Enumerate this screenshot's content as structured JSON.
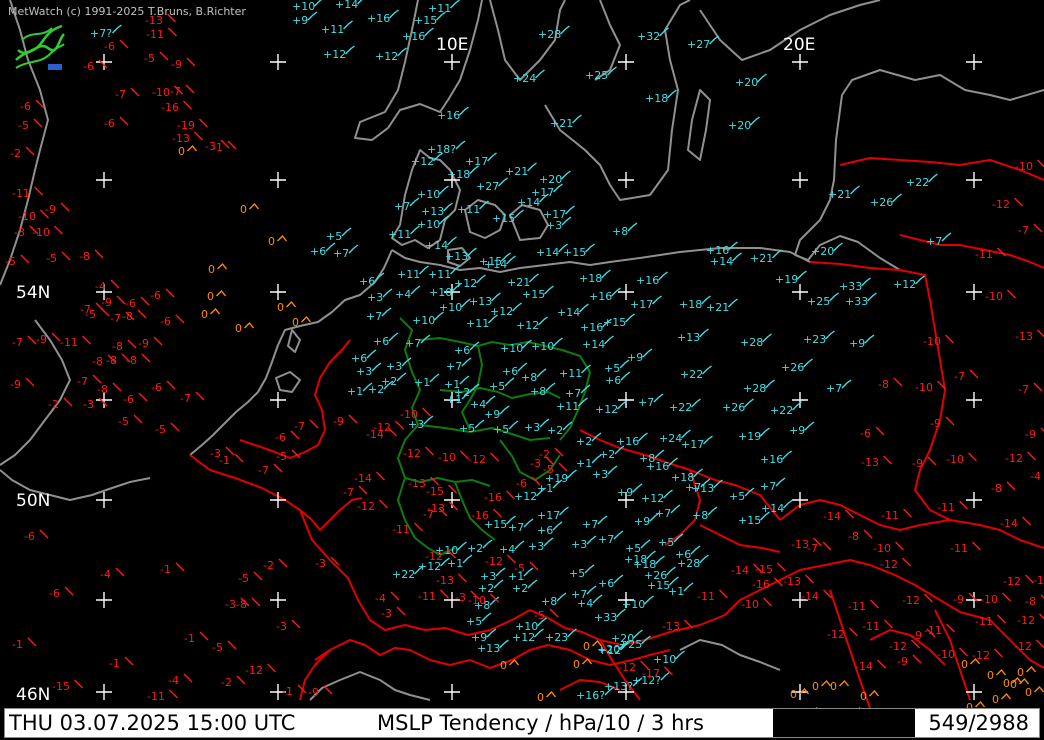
{
  "copyright": "MetWatch  (c) 1991-2025 T.Bruns, B.Richter",
  "footer": {
    "datetime": "THU 03.07.2025 15:00 UTC",
    "parameter": "MSLP Tendency / hPa/10 / 3 hrs",
    "counter": "549/2988"
  },
  "grid_labels": {
    "lon_10e": "10E",
    "lon_20e": "20E",
    "lat_54n": "54N",
    "lat_50n": "50N",
    "lat_46n": "46N"
  },
  "colors": {
    "background": "#000000",
    "positive": "#40e0e8",
    "negative": "#ff1818",
    "zero": "#ff8c00",
    "coastline": "#909090",
    "border_international": "#e00000",
    "border_germany": "#0f7a0f",
    "grid_cross": "#ffffff"
  },
  "observations": [
    {
      "v": "+10",
      "c": "pos"
    },
    {
      "v": "+14",
      "c": "pos"
    },
    {
      "v": "+11",
      "c": "pos"
    },
    {
      "v": "+9",
      "c": "pos"
    },
    {
      "v": "+16",
      "c": "pos"
    },
    {
      "v": "+15",
      "c": "pos"
    },
    {
      "v": "+11",
      "c": "pos"
    },
    {
      "v": "+16",
      "c": "pos"
    },
    {
      "v": "+12",
      "c": "pos"
    },
    {
      "v": "+12",
      "c": "pos"
    },
    {
      "v": "+28",
      "c": "pos"
    },
    {
      "v": "+32",
      "c": "pos"
    },
    {
      "v": "+27",
      "c": "pos"
    },
    {
      "v": "+24",
      "c": "pos"
    },
    {
      "v": "+25",
      "c": "pos"
    },
    {
      "v": "+20",
      "c": "pos"
    },
    {
      "v": "+18",
      "c": "pos"
    },
    {
      "v": "+20",
      "c": "pos"
    },
    {
      "v": "+21",
      "c": "pos"
    },
    {
      "v": "+16",
      "c": "pos"
    },
    {
      "v": "+18?",
      "c": "pos"
    },
    {
      "v": "+12",
      "c": "pos"
    },
    {
      "v": "+17",
      "c": "pos"
    },
    {
      "v": "+21",
      "c": "pos"
    },
    {
      "v": "+18",
      "c": "pos"
    },
    {
      "v": "+20",
      "c": "pos"
    },
    {
      "v": "+27",
      "c": "pos"
    },
    {
      "v": "+17",
      "c": "pos"
    },
    {
      "v": "+10",
      "c": "pos"
    },
    {
      "v": "+13",
      "c": "pos"
    },
    {
      "v": "+11",
      "c": "pos"
    },
    {
      "v": "+14",
      "c": "pos"
    },
    {
      "v": "+15",
      "c": "pos"
    },
    {
      "v": "+17",
      "c": "pos"
    },
    {
      "v": "+3",
      "c": "pos"
    },
    {
      "v": "+7",
      "c": "pos"
    },
    {
      "v": "+10",
      "c": "pos"
    },
    {
      "v": "+11",
      "c": "pos"
    },
    {
      "v": "+14",
      "c": "pos"
    },
    {
      "v": "+8",
      "c": "pos"
    },
    {
      "v": "+22",
      "c": "pos"
    },
    {
      "v": "+26",
      "c": "pos"
    },
    {
      "v": "+21",
      "c": "pos"
    },
    {
      "v": "+5",
      "c": "pos"
    },
    {
      "v": "+6",
      "c": "pos"
    },
    {
      "v": "+7",
      "c": "pos"
    },
    {
      "v": "+13",
      "c": "pos"
    },
    {
      "v": "+15",
      "c": "pos"
    },
    {
      "v": "+14",
      "c": "pos"
    },
    {
      "v": "+16",
      "c": "pos"
    },
    {
      "v": "+14",
      "c": "pos"
    },
    {
      "v": "+15",
      "c": "pos"
    },
    {
      "v": "+21",
      "c": "pos"
    },
    {
      "v": "+20",
      "c": "pos"
    },
    {
      "v": "+7",
      "c": "pos"
    },
    {
      "v": "+11",
      "c": "pos"
    },
    {
      "v": "+11",
      "c": "pos"
    },
    {
      "v": "+14",
      "c": "pos"
    },
    {
      "v": "+18",
      "c": "pos"
    },
    {
      "v": "+6",
      "c": "pos"
    },
    {
      "v": "+12",
      "c": "pos"
    },
    {
      "v": "+21",
      "c": "pos"
    },
    {
      "v": "+16",
      "c": "pos"
    },
    {
      "v": "+19",
      "c": "pos"
    },
    {
      "v": "+33",
      "c": "pos"
    },
    {
      "v": "+12",
      "c": "pos"
    },
    {
      "v": "+3",
      "c": "pos"
    },
    {
      "v": "+4",
      "c": "pos"
    },
    {
      "v": "+10",
      "c": "pos"
    },
    {
      "v": "+13",
      "c": "pos"
    },
    {
      "v": "+15",
      "c": "pos"
    },
    {
      "v": "+16",
      "c": "pos"
    },
    {
      "v": "+17",
      "c": "pos"
    },
    {
      "v": "+18",
      "c": "pos"
    },
    {
      "v": "+21",
      "c": "pos"
    },
    {
      "v": "+25",
      "c": "pos"
    },
    {
      "v": "+33",
      "c": "pos"
    },
    {
      "v": "+7",
      "c": "pos"
    },
    {
      "v": "+10",
      "c": "pos"
    },
    {
      "v": "+12",
      "c": "pos"
    },
    {
      "v": "+14",
      "c": "pos"
    },
    {
      "v": "+10",
      "c": "pos"
    },
    {
      "v": "+11",
      "c": "pos"
    },
    {
      "v": "+12",
      "c": "pos"
    },
    {
      "v": "+16",
      "c": "pos"
    },
    {
      "v": "+15",
      "c": "pos"
    },
    {
      "v": "+6",
      "c": "pos"
    },
    {
      "v": "+7",
      "c": "pos"
    },
    {
      "v": "+6",
      "c": "pos"
    },
    {
      "v": "+10",
      "c": "pos"
    },
    {
      "v": "+10",
      "c": "pos"
    },
    {
      "v": "+14",
      "c": "pos"
    },
    {
      "v": "+13",
      "c": "pos"
    },
    {
      "v": "+28",
      "c": "pos"
    },
    {
      "v": "+23",
      "c": "pos"
    },
    {
      "v": "+9",
      "c": "pos"
    },
    {
      "v": "+6",
      "c": "pos"
    },
    {
      "v": "+3",
      "c": "pos"
    },
    {
      "v": "+3",
      "c": "pos"
    },
    {
      "v": "+2",
      "c": "pos"
    },
    {
      "v": "+7",
      "c": "pos"
    },
    {
      "v": "+6",
      "c": "pos"
    },
    {
      "v": "+8",
      "c": "pos"
    },
    {
      "v": "+11",
      "c": "pos"
    },
    {
      "v": "+5",
      "c": "pos"
    },
    {
      "v": "+6",
      "c": "pos"
    },
    {
      "v": "+9",
      "c": "pos"
    },
    {
      "v": "+22",
      "c": "pos"
    },
    {
      "v": "+26",
      "c": "pos"
    },
    {
      "v": "+28",
      "c": "pos"
    },
    {
      "v": "+7",
      "c": "pos"
    },
    {
      "v": "+2",
      "c": "pos"
    },
    {
      "v": "+1",
      "c": "pos"
    },
    {
      "v": "+1",
      "c": "pos"
    },
    {
      "v": "+1",
      "c": "pos"
    },
    {
      "v": "+2",
      "c": "pos"
    },
    {
      "v": "+5",
      "c": "pos"
    },
    {
      "v": "+8",
      "c": "pos"
    },
    {
      "v": "+7",
      "c": "pos"
    },
    {
      "v": "+7",
      "c": "pos"
    },
    {
      "v": "+22",
      "c": "pos"
    },
    {
      "v": "+26",
      "c": "pos"
    },
    {
      "v": "+22",
      "c": "pos"
    },
    {
      "v": "+4",
      "c": "pos"
    },
    {
      "v": "+9",
      "c": "pos"
    },
    {
      "v": "+1",
      "c": "pos"
    },
    {
      "v": "+3",
      "c": "pos"
    },
    {
      "v": "+5",
      "c": "pos"
    },
    {
      "v": "+5",
      "c": "pos"
    },
    {
      "v": "+3",
      "c": "pos"
    },
    {
      "v": "+2",
      "c": "pos"
    },
    {
      "v": "+16",
      "c": "pos"
    },
    {
      "v": "+24",
      "c": "pos"
    },
    {
      "v": "+17",
      "c": "pos"
    },
    {
      "v": "+19",
      "c": "pos"
    },
    {
      "v": "+9",
      "c": "pos"
    },
    {
      "v": "+2",
      "c": "pos"
    },
    {
      "v": "+2",
      "c": "pos"
    },
    {
      "v": "+8",
      "c": "pos"
    },
    {
      "v": "+16",
      "c": "pos"
    },
    {
      "v": "+16",
      "c": "pos"
    },
    {
      "v": "+11",
      "c": "pos"
    },
    {
      "v": "+12",
      "c": "pos"
    },
    {
      "v": "+1",
      "c": "pos"
    },
    {
      "v": "+3",
      "c": "pos"
    },
    {
      "v": "+19",
      "c": "pos"
    },
    {
      "v": "+12",
      "c": "pos"
    },
    {
      "v": "+1",
      "c": "pos"
    },
    {
      "v": "+9",
      "c": "pos"
    },
    {
      "v": "+12",
      "c": "pos"
    },
    {
      "v": "+18",
      "c": "pos"
    },
    {
      "v": "+13",
      "c": "pos"
    },
    {
      "v": "+5",
      "c": "pos"
    },
    {
      "v": "+7",
      "c": "pos"
    },
    {
      "v": "+14",
      "c": "pos"
    },
    {
      "v": "+7",
      "c": "pos"
    },
    {
      "v": "+8",
      "c": "pos"
    },
    {
      "v": "+7",
      "c": "pos"
    },
    {
      "v": "+9",
      "c": "pos"
    },
    {
      "v": "+7",
      "c": "pos"
    },
    {
      "v": "+17",
      "c": "pos"
    },
    {
      "v": "+15",
      "c": "pos"
    },
    {
      "v": "+7",
      "c": "pos"
    },
    {
      "v": "+6",
      "c": "pos"
    },
    {
      "v": "+3",
      "c": "pos"
    },
    {
      "v": "+7",
      "c": "pos"
    },
    {
      "v": "+5",
      "c": "pos"
    },
    {
      "v": "+5",
      "c": "pos"
    },
    {
      "v": "+6",
      "c": "pos"
    },
    {
      "v": "+18",
      "c": "pos"
    },
    {
      "v": "+18",
      "c": "pos"
    },
    {
      "v": "+28",
      "c": "pos"
    },
    {
      "v": "+15",
      "c": "pos"
    },
    {
      "v": "+22",
      "c": "pos"
    },
    {
      "v": "+12",
      "c": "pos"
    },
    {
      "v": "+10",
      "c": "pos"
    },
    {
      "v": "+3",
      "c": "pos"
    },
    {
      "v": "+1",
      "c": "pos"
    },
    {
      "v": "+1",
      "c": "pos"
    },
    {
      "v": "+2",
      "c": "pos"
    },
    {
      "v": "+4",
      "c": "pos"
    },
    {
      "v": "+3",
      "c": "pos"
    },
    {
      "v": "+5",
      "c": "pos"
    },
    {
      "v": "+26",
      "c": "pos"
    },
    {
      "v": "+2",
      "c": "pos"
    },
    {
      "v": "+2",
      "c": "pos"
    },
    {
      "v": "+6",
      "c": "pos"
    },
    {
      "v": "+7",
      "c": "pos"
    },
    {
      "v": "+15",
      "c": "pos"
    },
    {
      "v": "+1",
      "c": "pos"
    },
    {
      "v": "+8",
      "c": "pos"
    },
    {
      "v": "+8",
      "c": "pos"
    },
    {
      "v": "+4",
      "c": "pos"
    },
    {
      "v": "+10",
      "c": "pos"
    },
    {
      "v": "+5",
      "c": "pos"
    },
    {
      "v": "+10",
      "c": "pos"
    },
    {
      "v": "+33",
      "c": "pos"
    },
    {
      "v": "+12",
      "c": "pos"
    },
    {
      "v": "+23",
      "c": "pos"
    },
    {
      "v": "+20",
      "c": "pos"
    },
    {
      "v": "+25",
      "c": "pos"
    },
    {
      "v": "+12",
      "c": "pos"
    },
    {
      "v": "+20",
      "c": "pos"
    },
    {
      "v": "+9",
      "c": "pos"
    },
    {
      "v": "+13",
      "c": "pos"
    },
    {
      "v": "+10",
      "c": "pos"
    },
    {
      "v": "+12?",
      "c": "pos"
    },
    {
      "v": "+13?",
      "c": "pos"
    },
    {
      "v": "+16?",
      "c": "pos"
    },
    {
      "v": "+7?",
      "c": "pos"
    },
    {
      "v": "-13",
      "c": "neg"
    },
    {
      "v": "-6",
      "c": "neg"
    },
    {
      "v": "-11",
      "c": "neg"
    },
    {
      "v": "-5",
      "c": "neg"
    },
    {
      "v": "-9",
      "c": "neg"
    },
    {
      "v": "-6",
      "c": "neg"
    },
    {
      "v": "-7",
      "c": "neg"
    },
    {
      "v": "-7",
      "c": "neg"
    },
    {
      "v": "-10",
      "c": "neg"
    },
    {
      "v": "-6",
      "c": "neg"
    },
    {
      "v": "-16",
      "c": "neg"
    },
    {
      "v": "-6",
      "c": "neg"
    },
    {
      "v": "-19",
      "c": "neg"
    },
    {
      "v": "-5",
      "c": "neg"
    },
    {
      "v": "-13",
      "c": "neg"
    },
    {
      "v": "-3",
      "c": "neg"
    },
    {
      "v": "-1",
      "c": "neg"
    },
    {
      "v": "-2",
      "c": "neg"
    },
    {
      "v": "-11",
      "c": "neg"
    },
    {
      "v": "-9",
      "c": "neg"
    },
    {
      "v": "-10",
      "c": "neg"
    },
    {
      "v": "-8",
      "c": "neg"
    },
    {
      "v": "-10",
      "c": "neg"
    },
    {
      "v": "-5",
      "c": "neg"
    },
    {
      "v": "-5",
      "c": "neg"
    },
    {
      "v": "-8",
      "c": "neg"
    },
    {
      "v": "-4",
      "c": "neg"
    },
    {
      "v": "-6",
      "c": "neg"
    },
    {
      "v": "-6",
      "c": "neg"
    },
    {
      "v": "-9",
      "c": "neg"
    },
    {
      "v": "-7",
      "c": "neg"
    },
    {
      "v": "-6",
      "c": "neg"
    },
    {
      "v": "-8",
      "c": "neg"
    },
    {
      "v": "-5",
      "c": "neg"
    },
    {
      "v": "-7",
      "c": "neg"
    },
    {
      "v": "-8",
      "c": "neg"
    },
    {
      "v": "-9",
      "c": "neg"
    },
    {
      "v": "-7",
      "c": "neg"
    },
    {
      "v": "-9",
      "c": "neg"
    },
    {
      "v": "-11",
      "c": "neg"
    },
    {
      "v": "-8",
      "c": "neg"
    },
    {
      "v": "-8",
      "c": "neg"
    },
    {
      "v": "-8",
      "c": "neg"
    },
    {
      "v": "-9",
      "c": "neg"
    },
    {
      "v": "-7",
      "c": "neg"
    },
    {
      "v": "-3",
      "c": "neg"
    },
    {
      "v": "-8",
      "c": "neg"
    },
    {
      "v": "-6",
      "c": "neg"
    },
    {
      "v": "-5",
      "c": "neg"
    },
    {
      "v": "-2",
      "c": "neg"
    },
    {
      "v": "-7",
      "c": "neg"
    },
    {
      "v": "-6",
      "c": "neg"
    },
    {
      "v": "-5",
      "c": "neg"
    },
    {
      "v": "-3",
      "c": "neg"
    },
    {
      "v": "-1",
      "c": "neg"
    },
    {
      "v": "-6",
      "c": "neg"
    },
    {
      "v": "-5",
      "c": "neg"
    },
    {
      "v": "-7",
      "c": "neg"
    },
    {
      "v": "-9",
      "c": "neg"
    },
    {
      "v": "-7",
      "c": "neg"
    },
    {
      "v": "-12",
      "c": "neg"
    },
    {
      "v": "-10",
      "c": "neg"
    },
    {
      "v": "-14",
      "c": "neg"
    },
    {
      "v": "-12",
      "c": "neg"
    },
    {
      "v": "-10",
      "c": "neg"
    },
    {
      "v": "-12",
      "c": "neg"
    },
    {
      "v": "-13",
      "c": "neg"
    },
    {
      "v": "-15",
      "c": "neg"
    },
    {
      "v": "-14",
      "c": "neg"
    },
    {
      "v": "-7",
      "c": "neg"
    },
    {
      "v": "-12",
      "c": "neg"
    },
    {
      "v": "-13",
      "c": "neg"
    },
    {
      "v": "-16",
      "c": "neg"
    },
    {
      "v": "-16",
      "c": "neg"
    },
    {
      "v": "-7",
      "c": "neg"
    },
    {
      "v": "-11",
      "c": "neg"
    },
    {
      "v": "-12",
      "c": "neg"
    },
    {
      "v": "-11",
      "c": "neg"
    },
    {
      "v": "-13",
      "c": "neg"
    },
    {
      "v": "-3",
      "c": "neg"
    },
    {
      "v": "-10",
      "c": "neg"
    },
    {
      "v": "-12",
      "c": "neg"
    },
    {
      "v": "-5",
      "c": "neg"
    },
    {
      "v": "-4",
      "c": "neg"
    },
    {
      "v": "-3",
      "c": "neg"
    },
    {
      "v": "-5",
      "c": "neg"
    },
    {
      "v": "-6",
      "c": "neg"
    },
    {
      "v": "-2",
      "c": "neg"
    },
    {
      "v": "-3",
      "c": "neg"
    },
    {
      "v": "-5",
      "c": "neg"
    },
    {
      "v": "-6",
      "c": "neg"
    },
    {
      "v": "-1",
      "c": "neg"
    },
    {
      "v": "-4",
      "c": "neg"
    },
    {
      "v": "-5",
      "c": "neg"
    },
    {
      "v": "-2",
      "c": "neg"
    },
    {
      "v": "-3",
      "c": "neg"
    },
    {
      "v": "-8",
      "c": "neg"
    },
    {
      "v": "-3",
      "c": "neg"
    },
    {
      "v": "-1",
      "c": "neg"
    },
    {
      "v": "-5",
      "c": "neg"
    },
    {
      "v": "-1",
      "c": "neg"
    },
    {
      "v": "-6",
      "c": "neg"
    },
    {
      "v": "-3",
      "c": "neg"
    },
    {
      "v": "-1",
      "c": "neg"
    },
    {
      "v": "-4",
      "c": "neg"
    },
    {
      "v": "-2",
      "c": "neg"
    },
    {
      "v": "-12",
      "c": "neg"
    },
    {
      "v": "-1",
      "c": "neg"
    },
    {
      "v": "-9",
      "c": "neg"
    },
    {
      "v": "-15",
      "c": "neg"
    },
    {
      "v": "-11",
      "c": "neg"
    },
    {
      "v": "-10",
      "c": "neg"
    },
    {
      "v": "-12",
      "c": "neg"
    },
    {
      "v": "-7",
      "c": "neg"
    },
    {
      "v": "-11",
      "c": "neg"
    },
    {
      "v": "-10",
      "c": "neg"
    },
    {
      "v": "-13",
      "c": "neg"
    },
    {
      "v": "-7",
      "c": "neg"
    },
    {
      "v": "-9",
      "c": "neg"
    },
    {
      "v": "-12",
      "c": "neg"
    },
    {
      "v": "-4",
      "c": "neg"
    },
    {
      "v": "-8",
      "c": "neg"
    },
    {
      "v": "-10",
      "c": "neg"
    },
    {
      "v": "-9",
      "c": "neg"
    },
    {
      "v": "-13",
      "c": "neg"
    },
    {
      "v": "-7",
      "c": "neg"
    },
    {
      "v": "-10",
      "c": "neg"
    },
    {
      "v": "-8",
      "c": "neg"
    },
    {
      "v": "-10",
      "c": "neg"
    },
    {
      "v": "-6",
      "c": "neg"
    },
    {
      "v": "-9",
      "c": "neg"
    },
    {
      "v": "-11",
      "c": "neg"
    },
    {
      "v": "-11",
      "c": "neg"
    },
    {
      "v": "-8",
      "c": "neg"
    },
    {
      "v": "-7",
      "c": "neg"
    },
    {
      "v": "-14",
      "c": "neg"
    },
    {
      "v": "-13",
      "c": "neg"
    },
    {
      "v": "-10",
      "c": "neg"
    },
    {
      "v": "-11",
      "c": "neg"
    },
    {
      "v": "-12",
      "c": "neg"
    },
    {
      "v": "-14",
      "c": "neg"
    },
    {
      "v": "-12",
      "c": "neg"
    },
    {
      "v": "-11",
      "c": "neg"
    },
    {
      "v": "-10",
      "c": "neg"
    },
    {
      "v": "-8",
      "c": "neg"
    },
    {
      "v": "-9",
      "c": "neg"
    },
    {
      "v": "-12",
      "c": "neg"
    },
    {
      "v": "-11",
      "c": "neg"
    },
    {
      "v": "-14",
      "c": "neg"
    },
    {
      "v": "-16",
      "c": "neg"
    },
    {
      "v": "-11",
      "c": "neg"
    },
    {
      "v": "-13",
      "c": "neg"
    },
    {
      "v": "-12",
      "c": "neg"
    },
    {
      "v": "-17",
      "c": "neg"
    },
    {
      "v": "-10",
      "c": "neg"
    },
    {
      "v": "-14",
      "c": "neg"
    },
    {
      "v": "-15",
      "c": "neg"
    },
    {
      "v": "-13",
      "c": "neg"
    },
    {
      "v": "-12",
      "c": "neg"
    },
    {
      "v": "-11",
      "c": "neg"
    },
    {
      "v": "-9",
      "c": "neg"
    },
    {
      "v": "-11",
      "c": "neg"
    },
    {
      "v": "-12",
      "c": "neg"
    },
    {
      "v": "-14",
      "c": "neg"
    },
    {
      "v": "-9",
      "c": "neg"
    },
    {
      "v": "-12",
      "c": "neg"
    },
    {
      "v": "-12",
      "c": "neg"
    },
    {
      "v": "-10",
      "c": "neg"
    },
    {
      "v": "-11",
      "c": "neg"
    },
    {
      "v": "-12",
      "c": "neg"
    },
    {
      "v": "0",
      "c": "zero"
    },
    {
      "v": "0",
      "c": "zero"
    },
    {
      "v": "0",
      "c": "zero"
    },
    {
      "v": "0",
      "c": "zero"
    },
    {
      "v": "0",
      "c": "zero"
    },
    {
      "v": "0",
      "c": "zero"
    },
    {
      "v": "0",
      "c": "zero"
    },
    {
      "v": "0",
      "c": "zero"
    },
    {
      "v": "0",
      "c": "zero"
    },
    {
      "v": "0",
      "c": "zero"
    },
    {
      "v": "0",
      "c": "zero"
    },
    {
      "v": "0",
      "c": "zero"
    },
    {
      "v": "0",
      "c": "zero"
    },
    {
      "v": "0",
      "c": "zero"
    },
    {
      "v": "0",
      "c": "zero"
    },
    {
      "v": "0",
      "c": "zero"
    },
    {
      "v": "0",
      "c": "zero"
    },
    {
      "v": "0",
      "c": "zero"
    },
    {
      "v": "0",
      "c": "zero"
    },
    {
      "v": "0",
      "c": "zero"
    },
    {
      "v": "0",
      "c": "zero"
    },
    {
      "v": "0",
      "c": "zero"
    },
    {
      "v": "0",
      "c": "zero"
    },
    {
      "v": "0",
      "c": "zero"
    },
    {
      "v": "0",
      "c": "zero"
    },
    {
      "v": "0",
      "c": "zero"
    },
    {
      "v": "0",
      "c": "zero"
    }
  ]
}
